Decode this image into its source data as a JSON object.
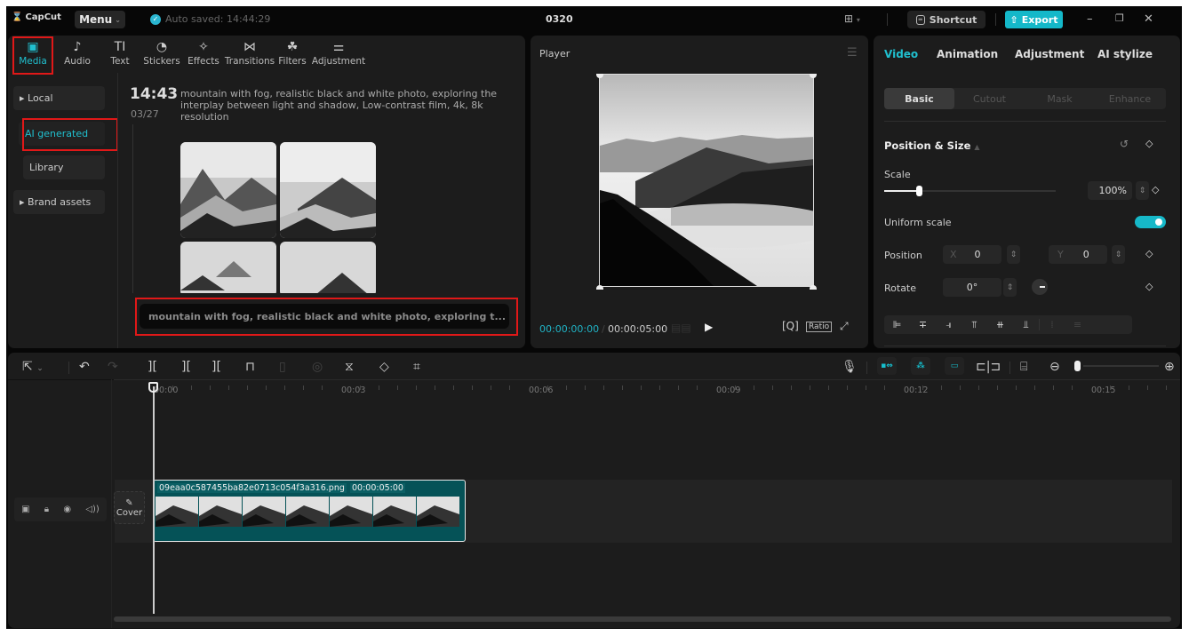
{
  "titlebar": {
    "app_name": "CapCut",
    "menu_label": "Menu",
    "autosave_text": "Auto saved: 14:44:29",
    "project_title": "0320",
    "shortcut_label": "Shortcut",
    "export_label": "Export",
    "minimize": "–",
    "maximize": "❐",
    "close": "✕"
  },
  "media_tabs": [
    {
      "label": "Media",
      "icon": "media-icon",
      "glyph": "▣",
      "active": true
    },
    {
      "label": "Audio",
      "icon": "audio-icon",
      "glyph": "♪"
    },
    {
      "label": "Text",
      "icon": "text-icon",
      "glyph": "TI"
    },
    {
      "label": "Stickers",
      "icon": "stickers-icon",
      "glyph": "◔"
    },
    {
      "label": "Effects",
      "icon": "effects-icon",
      "glyph": "✧"
    },
    {
      "label": "Transitions",
      "icon": "transitions-icon",
      "glyph": "⋈"
    },
    {
      "label": "Filters",
      "icon": "filters-icon",
      "glyph": "☘"
    },
    {
      "label": "Adjustment",
      "icon": "adjustment-icon",
      "glyph": "⚌"
    }
  ],
  "media_sidebar": [
    {
      "label": "▸ Local"
    },
    {
      "label": "AI generated",
      "active": true
    },
    {
      "label": "Library"
    },
    {
      "label": "▸ Brand assets"
    }
  ],
  "ai_result": {
    "time": "14:43",
    "date": "03/27",
    "prompt": "mountain with fog, realistic black and white photo, exploring the interplay between light and shadow, Low-contrast film, 4k, 8k resolution",
    "prompt_input_value": "mountain with fog, realistic black and white photo, exploring t..."
  },
  "player": {
    "title": "Player",
    "current_time": "00:00:00:00",
    "separator": "/",
    "total_time": "00:00:05:00",
    "ratio_label": "Ratio"
  },
  "properties": {
    "tabs": [
      {
        "label": "Video",
        "active": true
      },
      {
        "label": "Animation"
      },
      {
        "label": "Adjustment"
      },
      {
        "label": "AI stylize"
      }
    ],
    "subtabs": [
      {
        "label": "Basic",
        "active": true
      },
      {
        "label": "Cutout"
      },
      {
        "label": "Mask"
      },
      {
        "label": "Enhance"
      }
    ],
    "section_title": "Position & Size",
    "scale_label": "Scale",
    "scale_value": "100%",
    "scale_slider_fraction": 0.2,
    "uniform_scale_label": "Uniform scale",
    "uniform_scale_on": true,
    "position_label": "Position",
    "pos_x_label": "X",
    "pos_x_value": "0",
    "pos_y_label": "Y",
    "pos_y_value": "0",
    "rotate_label": "Rotate",
    "rotate_value": "0°"
  },
  "timeline": {
    "ruler_labels": [
      "00:00",
      "00:03",
      "00:06",
      "00:09",
      "00:12",
      "00:15"
    ],
    "clip_name": "09eaa0c587455ba82e0713c054f3a316.png",
    "clip_duration": "00:00:05:00",
    "cover_label": "Cover",
    "zoom_fraction": 0.05
  }
}
